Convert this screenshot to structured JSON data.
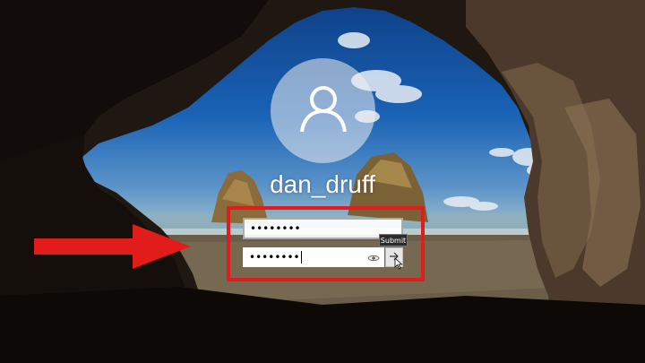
{
  "user": {
    "name": "dan_druff",
    "avatar_icon": "user-avatar-icon"
  },
  "login": {
    "field1_value": "••••••••",
    "field2_value": "••••••••",
    "reveal_icon": "eye-icon",
    "submit_icon": "arrow-right-icon",
    "submit_tooltip": "Submit"
  },
  "annotation": {
    "arrow_color": "#e21b1b",
    "box_color": "#e21b1b"
  }
}
